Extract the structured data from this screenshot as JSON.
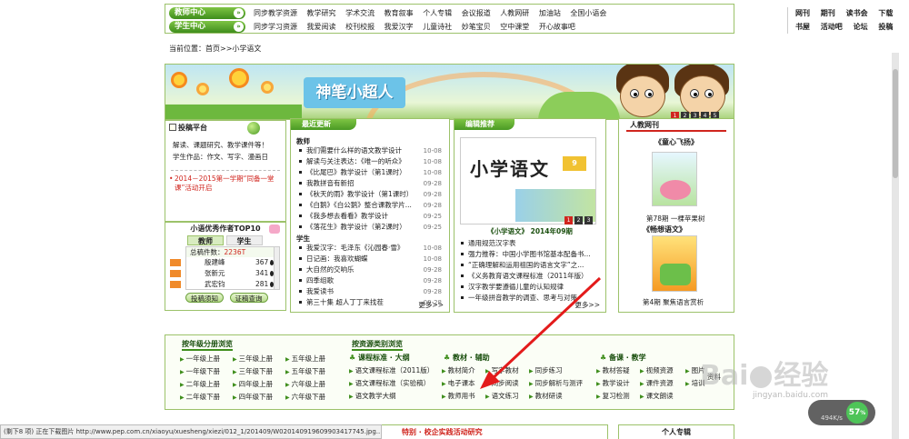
{
  "nav": {
    "teacher_center": "教师中心",
    "student_center": "学生中心",
    "row1": [
      "同步教学资源",
      "教学研究",
      "学术交流",
      "教育叙事",
      "个人专辑",
      "会议报道",
      "人教网研",
      "加油站",
      "全国小语会"
    ],
    "row2": [
      "同步学习资源",
      "我爱阅读",
      "校刊校报",
      "我爱汉字",
      "儿童诗社",
      "妙笔宝贝",
      "空中课堂",
      "开心故事吧"
    ],
    "right_row1": [
      "网刊",
      "期刊",
      "读书会",
      "下载"
    ],
    "right_row2": [
      "书屋",
      "活动吧",
      "论坛",
      "投稿"
    ]
  },
  "breadcrumb": "当前位置：首页>>小学语文",
  "banner": {
    "title": "神笔小超人",
    "pages": [
      "1",
      "2",
      "3",
      "4",
      "5"
    ]
  },
  "submit": {
    "title": "投稿平台",
    "text1": "解读、课题研究、教学课件等！",
    "text2": "学生作品：作文、写字、漫画日",
    "notice": "2014－2015第一学期“同备一堂课”活动开启"
  },
  "top10": {
    "title": "小语优秀作者TOP10",
    "tabs": [
      "教师",
      "学生"
    ],
    "total_label": "总稿件数：",
    "total": "2236T",
    "authors": [
      {
        "name": "殷建峰",
        "count": "367"
      },
      {
        "name": "张新元",
        "count": "341"
      },
      {
        "name": "武宏钧",
        "count": "281"
      }
    ],
    "btn_submit": "投稿须知",
    "btn_cert": "证稿查询"
  },
  "latest": {
    "title": "最近更新",
    "teacher_label": "教师",
    "teacher_items": [
      {
        "t": "我们需要什么样的语文教学设计",
        "d": "10-08"
      },
      {
        "t": "解读与关注表达：《唯一的听众》",
        "d": "10-08"
      },
      {
        "t": "《比尾巴》教学设计（第1课时）",
        "d": "10-08"
      },
      {
        "t": "我教拼音有新招",
        "d": "09-28"
      },
      {
        "t": "《秋天的雨》教学设计（第1课时）",
        "d": "09-28"
      },
      {
        "t": "《白鹅》《白公鹅》整合课教学片...",
        "d": "09-28"
      },
      {
        "t": "《我多想去看看》教学设计",
        "d": "09-25"
      },
      {
        "t": "《落花生》教学设计（第2课时）",
        "d": "09-25"
      }
    ],
    "student_label": "学生",
    "student_items": [
      {
        "t": "我爱汉字：毛泽东《沁园春·雪》",
        "d": "10-08"
      },
      {
        "t": "日记画：我喜欢蝴蝶",
        "d": "10-08"
      },
      {
        "t": "大自然的交响乐",
        "d": "09-28"
      },
      {
        "t": "四季组歌",
        "d": "09-28"
      },
      {
        "t": "我爱读书",
        "d": "09-28"
      },
      {
        "t": "第三十集  超人丁丁来找茬",
        "d": "09-28"
      }
    ],
    "more": "更多>>"
  },
  "editor": {
    "title": "编辑推荐",
    "mag_title": "小学语文",
    "mag_issue": "9",
    "caption_book": "《小学语文》",
    "caption_issue": "2014年09期",
    "pages": [
      "1",
      "2",
      "3"
    ],
    "items": [
      "通用规范汉字表",
      "强力推荐：中国小学图书馆基本配备书...",
      "“正确理解和运用祖国的语言文字”之...",
      "《义务教育语文课程标准（2011年版）",
      "汉字教学要遵循儿童的认知规律",
      "一年级拼音教学的调查、思考与对策"
    ],
    "more": "更多>>"
  },
  "webmag": {
    "title": "人教网刊",
    "mag1_name": "《童心飞扬》",
    "mag1_caption": "第78期 一棵苹果树",
    "mag2_name": "《畅想语文》",
    "mag2_caption": "第4期  聚焦语言赏析"
  },
  "browse": {
    "grade_title": "按年级分册浏览",
    "grades": [
      [
        "一年级上册",
        "三年级上册",
        "五年级上册"
      ],
      [
        "一年级下册",
        "三年级下册",
        "五年级下册"
      ],
      [
        "二年级上册",
        "四年级上册",
        "六年级上册"
      ],
      [
        "二年级下册",
        "四年级下册",
        "六年级下册"
      ]
    ],
    "type_title": "按资源类别浏览",
    "col1_title": "课程标准 · 大纲",
    "col1": [
      "语文课程标准（2011版）",
      "语文课程标准（实验稿）",
      "语文教学大纲"
    ],
    "col2_title": "教材 · 辅助",
    "col2": [
      "教材简介",
      "写字教材",
      "电子课本",
      "同步阅读",
      "教师用书",
      "语文练习"
    ],
    "col3": [
      "同步练习",
      "同步解析与测评",
      "教材研读"
    ],
    "col4_title": "备课 · 教学",
    "col4": [
      "教材答疑",
      "教学设计",
      "复习检测"
    ],
    "col5": [
      "视频资源",
      "课件资源",
      "课文朗读"
    ],
    "col6": [
      "图片",
      "培训",
      "资料"
    ]
  },
  "lower": {
    "activity": "特别 · 校企实践活动研究",
    "personal": "个人专辑"
  },
  "statusbar": "(剩下8 项) 正在下载图片 http://www.pep.com.cn/xiaoyu/xuesheng/xiezi/012_1/201409/W020140919609903417745.jpg...",
  "speed": {
    "percent": "57",
    "unit": "%",
    "rate": "494K/s"
  },
  "watermark": {
    "brand": "Bai",
    "brand2": "经验",
    "url": "jingyan.baidu.com"
  }
}
